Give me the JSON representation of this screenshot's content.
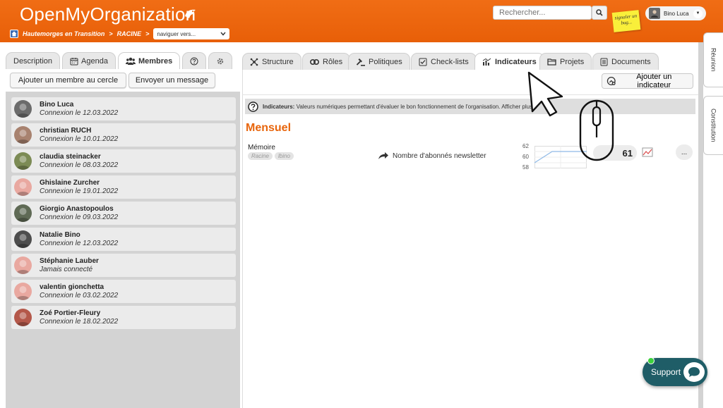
{
  "header": {
    "app_title": "OpenMyOrganization",
    "search_placeholder": "Rechercher...",
    "bug_note": "signaler un bug...",
    "user_name": "Bino Luca"
  },
  "breadcrumb": {
    "items": [
      "Hautemorges en Transition",
      ">",
      "RACINE",
      ">"
    ],
    "navigate_select": "naviguer vers..."
  },
  "left_tabs": [
    {
      "label": "Description"
    },
    {
      "label": "Agenda",
      "icon": "calendar-icon"
    },
    {
      "label": "Membres",
      "icon": "users-icon"
    },
    {
      "label": "",
      "icon": "help-icon"
    },
    {
      "label": "",
      "icon": "gear-icon"
    }
  ],
  "left_actions": {
    "add_member": "Ajouter un membre au cercle",
    "send_message": "Envoyer un message"
  },
  "members": [
    {
      "name": "Bino Luca",
      "status": "Connexion le 12.03.2022",
      "avatar_color": "#6b6b6b"
    },
    {
      "name": "christian RUCH",
      "status": "Connexion le 10.01.2022",
      "avatar_color": "#a8826f"
    },
    {
      "name": "claudia steinacker",
      "status": "Connexion le 08.03.2022",
      "avatar_color": "#7c8b55"
    },
    {
      "name": "Ghislaine Zurcher",
      "status": "Connexion le 19.01.2022",
      "avatar_color": "#e9a8a0"
    },
    {
      "name": "Giorgio Anastopoulos",
      "status": "Connexion le 09.03.2022",
      "avatar_color": "#5f6a55"
    },
    {
      "name": "Natalie Bino",
      "status": "Connexion le 12.03.2022",
      "avatar_color": "#4d4d4d"
    },
    {
      "name": "Stéphanie Lauber",
      "status": "Jamais connecté",
      "avatar_color": "#e9a8a0"
    },
    {
      "name": "valentin gionchetta",
      "status": "Connexion le 03.02.2022",
      "avatar_color": "#e9a8a0"
    },
    {
      "name": "Zoé Portier-Fleury",
      "status": "Connexion le 18.02.2022",
      "avatar_color": "#b4584a"
    }
  ],
  "right_tabs": [
    {
      "label": "Structure",
      "icon": "structure-icon"
    },
    {
      "label": "Rôles",
      "icon": "roles-icon"
    },
    {
      "label": "Politiques",
      "icon": "gavel-icon"
    },
    {
      "label": "Check-lists",
      "icon": "checklist-icon"
    },
    {
      "label": "Indicateurs",
      "icon": "chart-icon"
    },
    {
      "label": "Projets",
      "icon": "folder-icon"
    },
    {
      "label": "Documents",
      "icon": "document-icon"
    }
  ],
  "indicators": {
    "add_button": "Ajouter un indicateur",
    "info_label": "Indicateurs:",
    "info_text": "Valeurs numériques permettant d'évaluer le bon fonctionnement de l'organisation. Afficher plus...",
    "section": "Mensuel",
    "item": {
      "name": "Mémoire",
      "tags": [
        "Racine",
        "lbino"
      ],
      "metric": "Nombre d'abonnés newsletter",
      "y_labels": [
        "62",
        "60",
        "58"
      ],
      "value": "61",
      "more": "..."
    }
  },
  "side_tabs": [
    "Réunion",
    "Constitution"
  ],
  "support": {
    "label": "Support"
  },
  "colors": {
    "brand_orange": "#e8650c",
    "support_teal": "#1f5d67"
  }
}
